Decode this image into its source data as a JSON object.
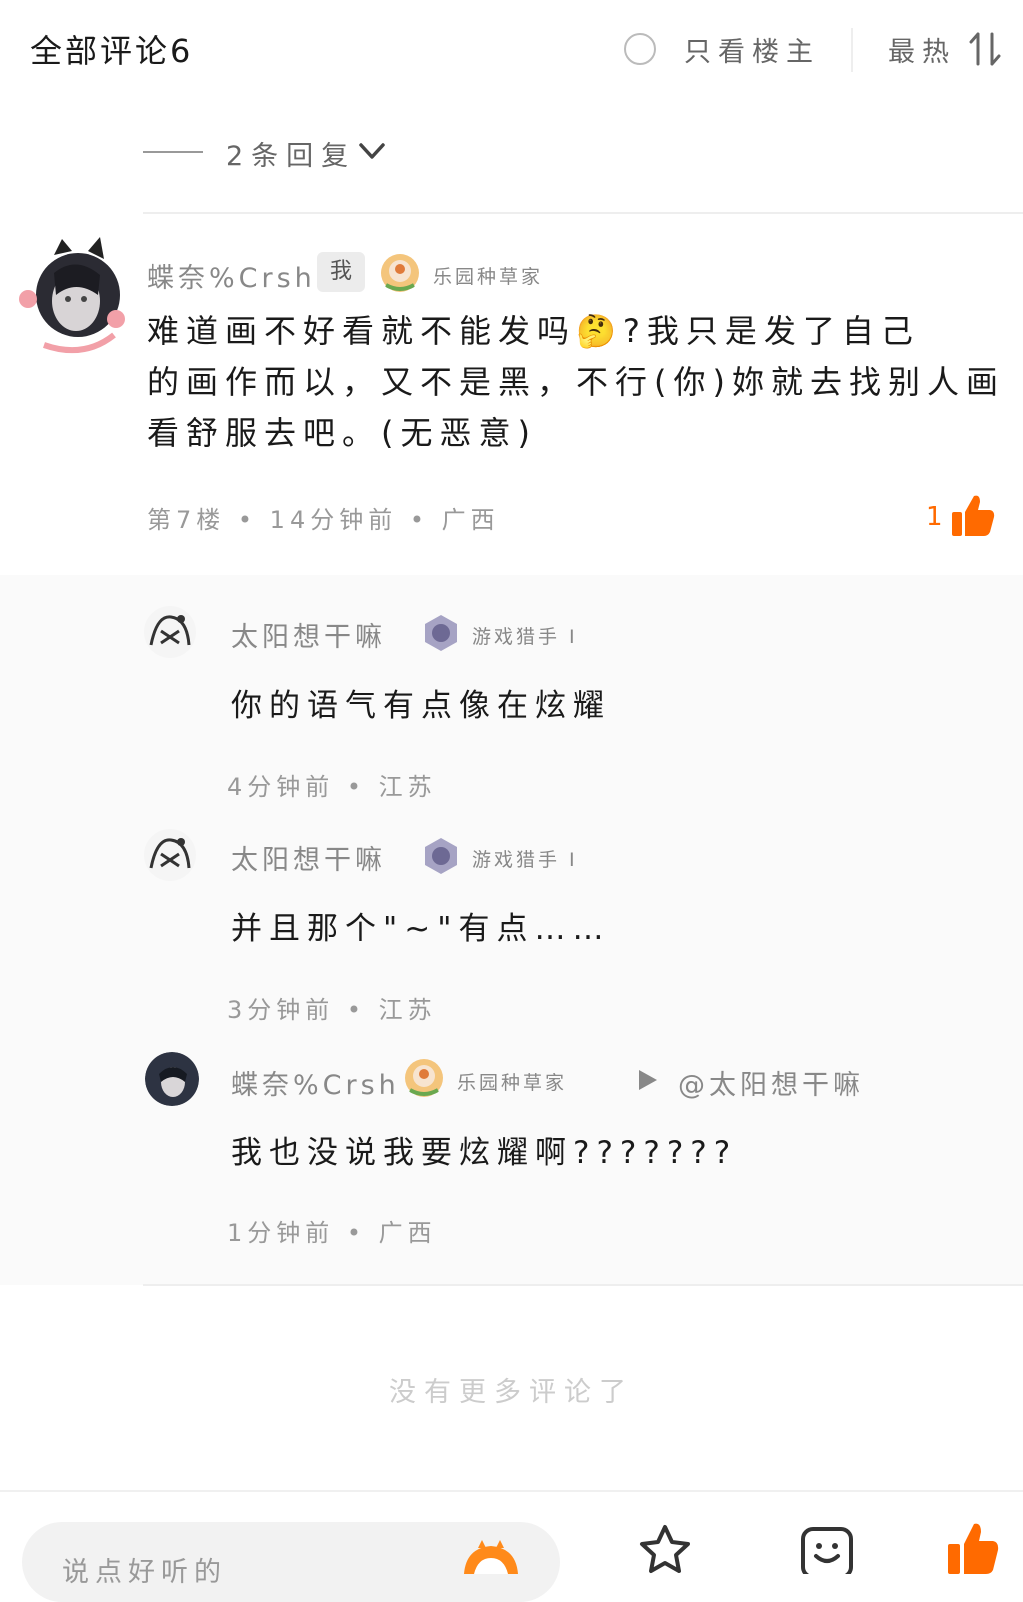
{
  "header": {
    "title": "全部评论6",
    "only_owner": "只看楼主",
    "sort_label": "最热"
  },
  "collapse": {
    "label": "2条回复"
  },
  "main_comment": {
    "user": "蝶奈%Crsh",
    "me_badge": "我",
    "medal": "乐园种草家",
    "lines": [
      "难道画不好看就不能发吗🤔?我只是发了自己",
      "的画作而以，又不是黑，不行(你)妳就去找别人画",
      "看舒服去吧。(无恶意)"
    ],
    "meta": "第7楼 • 14分钟前 • 广西",
    "likes": "1"
  },
  "replies": [
    {
      "user": "太阳想干嘛",
      "medal": "游戏猎手 I",
      "text": "你的语气有点像在炫耀",
      "meta": "4分钟前 • 江苏"
    },
    {
      "user": "太阳想干嘛",
      "medal": "游戏猎手 I",
      "text": "并且那个\"~\"有点……",
      "meta": "3分钟前 • 江苏"
    },
    {
      "user": "蝶奈%Crsh",
      "medal": "乐园种草家",
      "reply_to": "@太阳想干嘛",
      "text": "我也没说我要炫耀啊???????",
      "meta": "1分钟前 • 广西"
    }
  ],
  "footer": {
    "no_more": "没有更多评论了",
    "input_placeholder": "说点好听的"
  },
  "colors": {
    "accent": "#ff6a00",
    "text_primary": "#1a1a1a",
    "text_muted": "#999999"
  },
  "icons": [
    "radio-icon",
    "sort-icon",
    "chevron-down-icon",
    "thumb-up-icon",
    "play-icon",
    "star-icon",
    "emoji-icon"
  ]
}
